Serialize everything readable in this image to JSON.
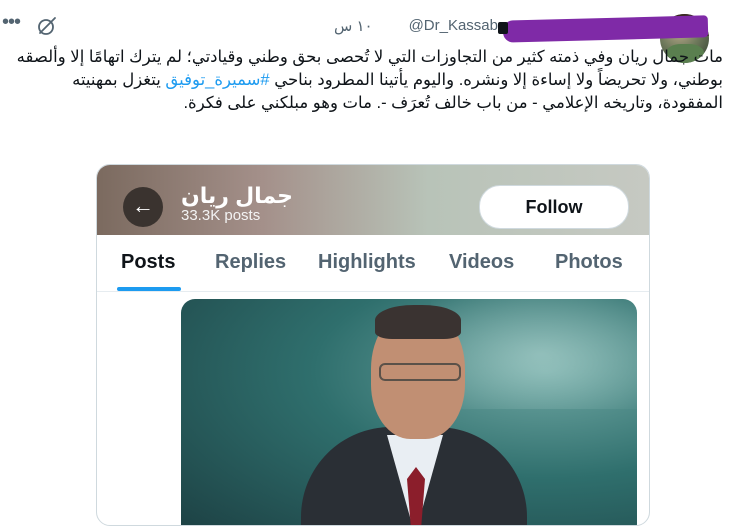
{
  "tweet": {
    "handle": "@Dr_Kassab",
    "timestamp": "١٠ س",
    "text_before_hashtag": "مات جمال ريان وفي ذمته كثير من التجاوزات التي لا تُحصى بحق وطني وقيادتي؛ لم يترك اتهامًا إلا وألصقه بوطني، ولا تحريضاً ولا إساءة إلا ونشره. واليوم يأتينا المطرود بناحي ",
    "hashtag": "#سميرة_توفيق",
    "text_after_hashtag": " يتغزل بمهنيته المفقودة، وتاريخه الإعلامي - من باب خالف تُعرَف -. مات وهو مبلكني على فكرة.",
    "more_icon": "more-horizontal-icon",
    "grok_icon": "grok-icon",
    "accent_color": "#1d9bf0"
  },
  "embedded_card": {
    "profile_name": "جمال ريان",
    "posts_count": "33.3K posts",
    "follow_label": "Follow",
    "back_icon": "back-arrow-icon",
    "tabs": [
      {
        "label": "Posts",
        "active": true
      },
      {
        "label": "Replies",
        "active": false
      },
      {
        "label": "Highlights",
        "active": false
      },
      {
        "label": "Videos",
        "active": false
      },
      {
        "label": "Photos",
        "active": false
      }
    ]
  }
}
